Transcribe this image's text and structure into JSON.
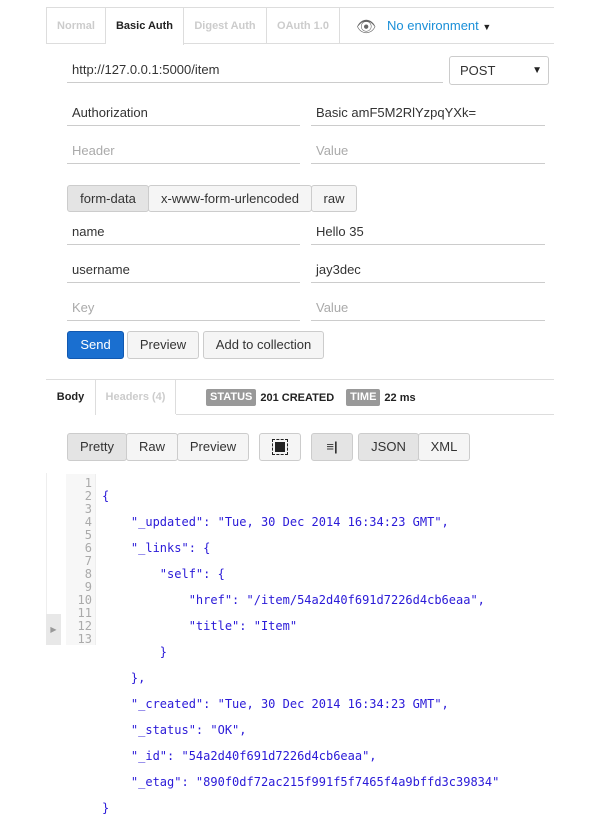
{
  "auth_tabs": [
    {
      "label": "Normal"
    },
    {
      "label": "Basic Auth"
    },
    {
      "label": "Digest Auth"
    },
    {
      "label": "OAuth 1.0"
    }
  ],
  "environment": {
    "icon": "eye-icon",
    "label": "No environment",
    "color": "#1a8fd8"
  },
  "request": {
    "url": "http://127.0.0.1:5000/item",
    "method": "POST"
  },
  "headers": [
    {
      "key": "Authorization",
      "value": "Basic amF5M2RlYzpqYXk="
    }
  ],
  "header_placeholders": {
    "key": "Header",
    "value": "Value"
  },
  "body_modes": [
    {
      "label": "form-data"
    },
    {
      "label": "x-www-form-urlencoded"
    },
    {
      "label": "raw"
    }
  ],
  "form": [
    {
      "key": "name",
      "value": "Hello 35"
    },
    {
      "key": "username",
      "value": "jay3dec"
    }
  ],
  "form_placeholders": {
    "key": "Key",
    "value": "Value"
  },
  "actions": {
    "send": "Send",
    "preview": "Preview",
    "add": "Add to collection"
  },
  "response": {
    "tabs": [
      {
        "label": "Body"
      },
      {
        "label": "Headers (4)"
      }
    ],
    "status_label": "STATUS",
    "status": "201 CREATED",
    "time_label": "TIME",
    "time": "22 ms"
  },
  "view_modes": [
    {
      "label": "Pretty"
    },
    {
      "label": "Raw"
    },
    {
      "label": "Preview"
    }
  ],
  "formats": [
    {
      "label": "JSON"
    },
    {
      "label": "XML"
    }
  ],
  "code_lines": [
    "{",
    "    \"_updated\": \"Tue, 30 Dec 2014 16:34:23 GMT\",",
    "    \"_links\": {",
    "        \"self\": {",
    "            \"href\": \"/item/54a2d40f691d7226d4cb6eaa\",",
    "            \"title\": \"Item\"",
    "        }",
    "    },",
    "    \"_created\": \"Tue, 30 Dec 2014 16:34:23 GMT\",",
    "    \"_status\": \"OK\",",
    "    \"_id\": \"54a2d40f691d7226d4cb6eaa\",",
    "    \"_etag\": \"890f0df72ac215f991f5f7465f4a9bffd3c39834\"",
    "}"
  ]
}
